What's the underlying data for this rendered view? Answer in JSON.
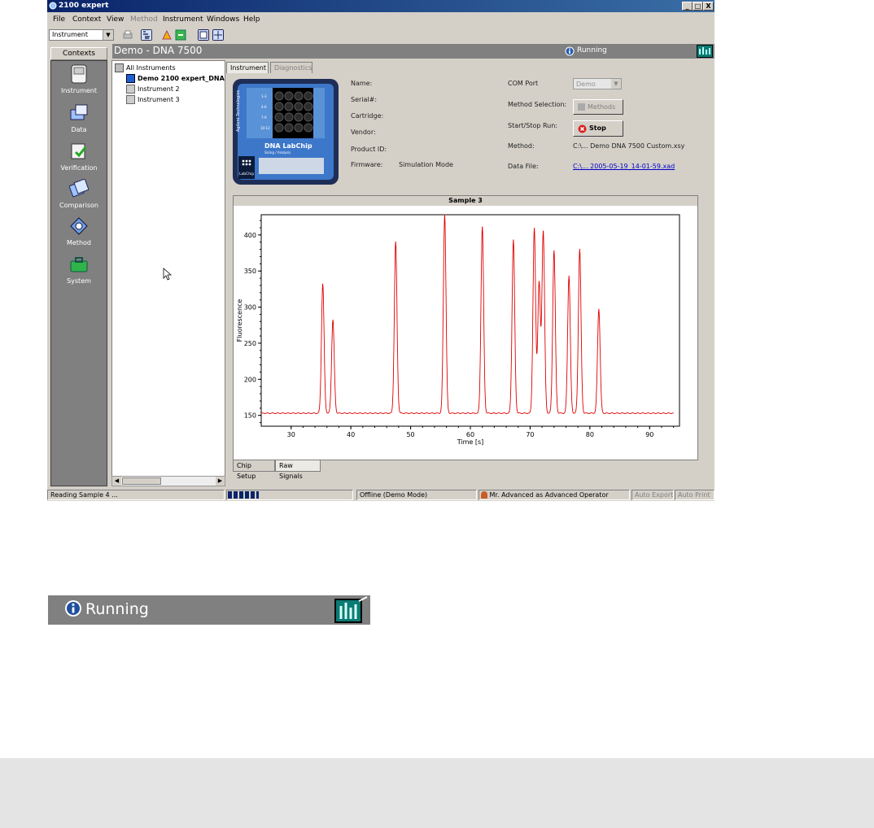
{
  "window": {
    "title": "2100 expert",
    "controls": [
      "_",
      "□",
      "X"
    ]
  },
  "menu": [
    {
      "label": "File"
    },
    {
      "label": "Context"
    },
    {
      "label": "View"
    },
    {
      "label": "Method",
      "disabled": true
    },
    {
      "label": "Instrument"
    },
    {
      "label": "Windows"
    },
    {
      "label": "Help"
    }
  ],
  "toolbar": {
    "context_select": "Instrument"
  },
  "contexts": {
    "header": "Contexts",
    "items": [
      {
        "label": "Instrument",
        "icon": "instrument-icon"
      },
      {
        "label": "Data",
        "icon": "data-icon"
      },
      {
        "label": "Verification",
        "icon": "verification-icon"
      },
      {
        "label": "Comparison",
        "icon": "comparison-icon"
      },
      {
        "label": "Method",
        "icon": "method-icon"
      },
      {
        "label": "System",
        "icon": "system-icon"
      }
    ]
  },
  "tree": {
    "root": "All Instruments",
    "items": [
      "Demo 2100 expert_DNA",
      "Instrument 2",
      "Instrument 3"
    ]
  },
  "header": {
    "title": "Demo - DNA 7500",
    "status": "Running"
  },
  "tabs": [
    "Instrument",
    "Diagnostics"
  ],
  "chip": {
    "brand": "Agilent Technologies",
    "product": "DNA LabChip",
    "subtitle": "Sizing / Analysis",
    "logo": "LabChip",
    "wells": [
      "1-3",
      "4-6",
      "7-9",
      "10-12"
    ]
  },
  "info": {
    "name_label": "Name:",
    "serial_label": "Serial#:",
    "cartridge_label": "Cartridge:",
    "vendor_label": "Vendor:",
    "product_label": "Product ID:",
    "firmware_label": "Firmware:",
    "firmware_value": "Simulation Mode",
    "com_label": "COM Port",
    "com_value": "Demo",
    "method_sel_label": "Method Selection:",
    "methods_button": "Methods",
    "startstop_label": "Start/Stop Run:",
    "stop_button": "Stop",
    "method_label": "Method:",
    "method_value": "C:\\... Demo DNA 7500 Custom.xsy",
    "datafile_label": "Data File:",
    "datafile_value": "C:\\... 2005-05-19_14-01-59.xad"
  },
  "chart_data": {
    "type": "line",
    "title": "Sample 3",
    "xlabel": "Time [s]",
    "ylabel": "Fluorescence",
    "xlim": [
      25,
      95
    ],
    "ylim": [
      135,
      428
    ],
    "xticks": [
      30,
      40,
      50,
      60,
      70,
      80,
      90
    ],
    "yticks": [
      150,
      200,
      250,
      300,
      350,
      400
    ],
    "baseline": 153,
    "color": "#e00000",
    "peaks": [
      {
        "x": 35.3,
        "y": 332
      },
      {
        "x": 37.0,
        "y": 282
      },
      {
        "x": 47.5,
        "y": 390
      },
      {
        "x": 55.7,
        "y": 428
      },
      {
        "x": 62.0,
        "y": 411
      },
      {
        "x": 67.2,
        "y": 393
      },
      {
        "x": 70.7,
        "y": 409
      },
      {
        "x": 71.5,
        "y": 334
      },
      {
        "x": 72.2,
        "y": 405
      },
      {
        "x": 74.0,
        "y": 378
      },
      {
        "x": 76.5,
        "y": 343
      },
      {
        "x": 78.3,
        "y": 380
      },
      {
        "x": 81.5,
        "y": 297
      }
    ]
  },
  "bottom_tabs": [
    "Chip Setup",
    "Raw Signals"
  ],
  "status": {
    "message": "Reading Sample 4 ...",
    "progress": 0.25,
    "mode": "Offline (Demo Mode)",
    "user": "Mr. Advanced as Advanced Operator",
    "auto_export": "Auto Export",
    "auto_print": "Auto Print"
  },
  "zoom": {
    "status": "Running"
  }
}
